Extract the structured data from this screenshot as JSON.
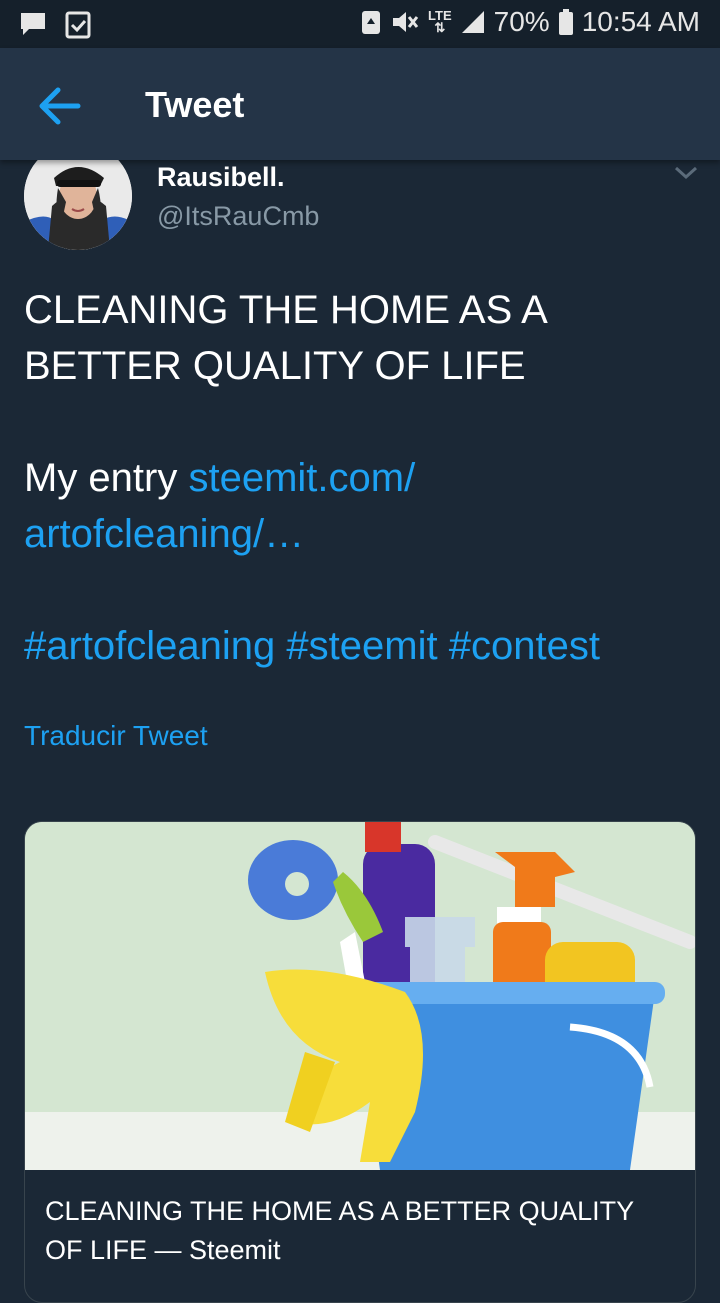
{
  "status_bar": {
    "lte": "LTE",
    "battery": "70%",
    "time": "10:54 AM"
  },
  "app_bar": {
    "title": "Tweet"
  },
  "author": {
    "name": "Rausibell.",
    "handle": "@ItsRauCmb"
  },
  "tweet": {
    "line1": "CLEANING THE HOME AS A BETTER QUALITY OF LIFE",
    "entry_prefix": "My entry ",
    "entry_link": "steemit.com/ artofcleaning/…",
    "hashtags": [
      "#artofcleaning",
      "#steemit",
      "#contest"
    ],
    "translate_label": "Traducir Tweet"
  },
  "card": {
    "title": "CLEANING THE HOME AS A BETTER QUALITY OF LIFE — Steemit"
  },
  "colors": {
    "background": "#1b2836",
    "app_bar": "#243447",
    "link": "#1da1f2",
    "secondary_text": "#8899a6"
  }
}
